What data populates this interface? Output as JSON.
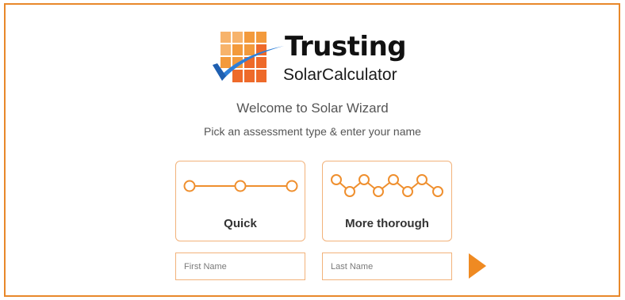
{
  "brand": {
    "title": "Trusting",
    "subtitle": "SolarCalculator",
    "colors": {
      "accent": "#e8882a",
      "panel_light": "#f7b36b",
      "panel_mid": "#f39a3c",
      "panel_dark": "#ee6a2a",
      "check": "#2e7fd8"
    }
  },
  "intro": {
    "welcome": "Welcome to Solar Wizard",
    "instruction": "Pick an assessment type & enter your name"
  },
  "assessment": {
    "quick": {
      "label": "Quick",
      "icon": "three-node-line-icon"
    },
    "thorough": {
      "label": "More thorough",
      "icon": "zigzag-nodes-icon"
    }
  },
  "form": {
    "first_name_placeholder": "First Name",
    "last_name_placeholder": "Last Name"
  },
  "next_icon": "play-arrow-icon"
}
